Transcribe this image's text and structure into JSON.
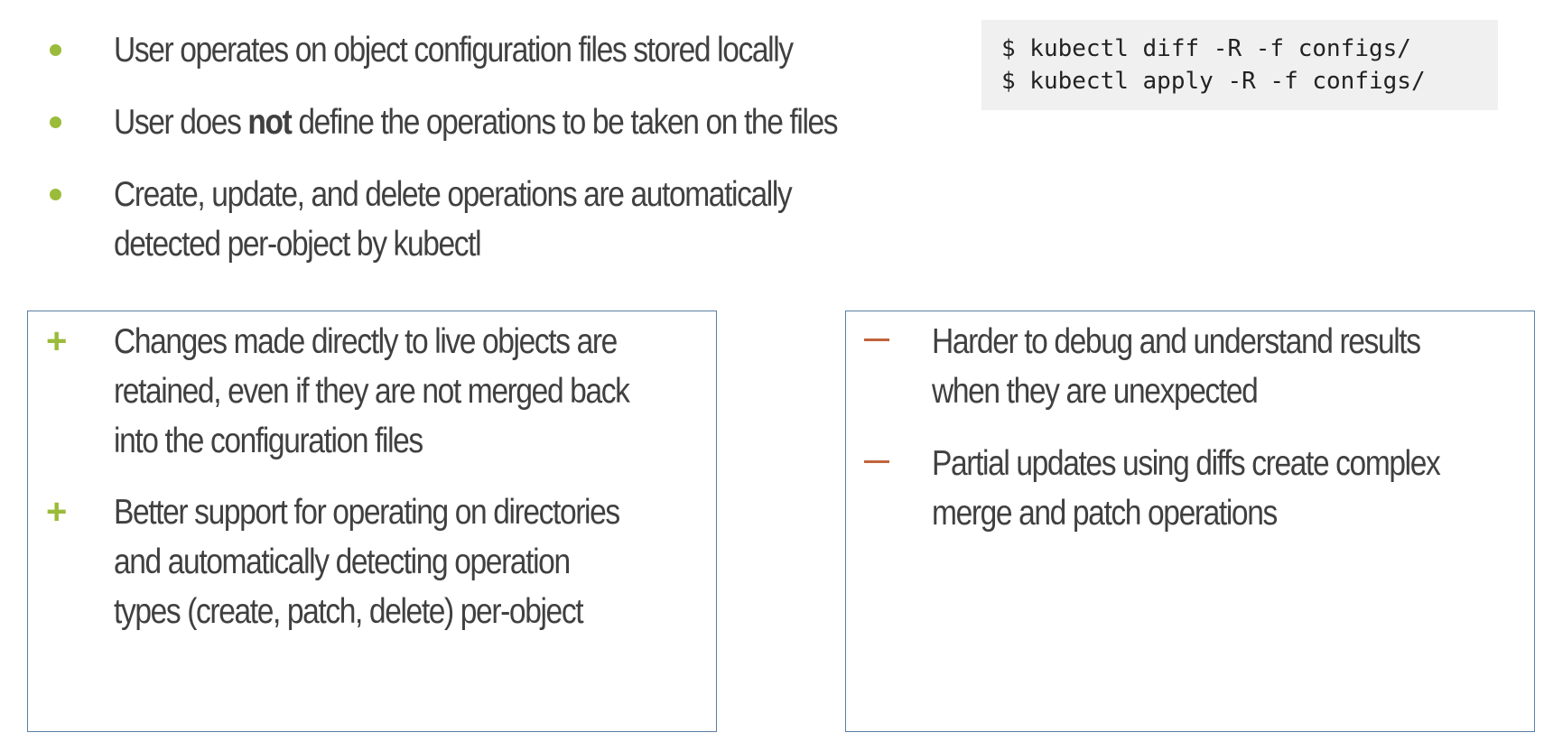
{
  "bullets": [
    {
      "pre": "User operates on object configuration files stored locally",
      "bold": "",
      "post": ""
    },
    {
      "pre": "User does ",
      "bold": "not",
      "post": " define the operations to be taken on the files"
    },
    {
      "line1": "Create, update, and delete operations are automatically",
      "line2": "detected per-object by kubectl"
    }
  ],
  "code": {
    "line1": "$ kubectl diff -R -f configs/",
    "line2": "$ kubectl apply -R -f configs/"
  },
  "pros": {
    "marker": "+",
    "items": [
      {
        "lines": [
          "Changes made directly to live objects are",
          "retained, even if they are not merged back",
          "into the configuration files"
        ]
      },
      {
        "lines": [
          "Better support for operating on directories",
          "and automatically detecting operation",
          "types (create, patch, delete) per-object"
        ]
      }
    ]
  },
  "cons": {
    "marker": "–",
    "items": [
      {
        "lines": [
          "Harder to debug and understand results",
          "when they are unexpected"
        ]
      },
      {
        "lines": [
          "Partial updates using diffs create complex",
          "merge and patch operations"
        ]
      }
    ]
  },
  "colors": {
    "bullet": "#9bbb3a",
    "plus": "#9bbb3a",
    "minus": "#c0643b",
    "panel_border": "#5b7fa3",
    "code_bg": "#f0f0f0",
    "text": "#404040"
  }
}
